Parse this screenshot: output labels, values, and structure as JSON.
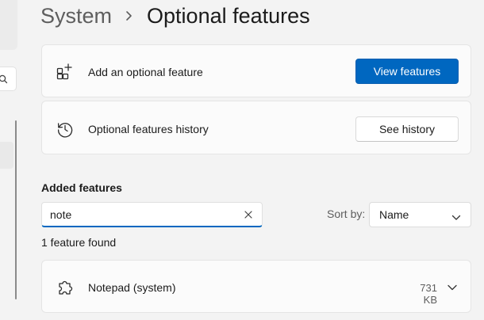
{
  "breadcrumb": {
    "parent": "System",
    "current": "Optional features"
  },
  "add_card": {
    "label": "Add an optional feature",
    "button": "View features",
    "icon": "apps-add-icon"
  },
  "history_card": {
    "label": "Optional features history",
    "button": "See history",
    "icon": "history-icon"
  },
  "added_features": {
    "title": "Added features",
    "search": {
      "value": "note"
    },
    "sort": {
      "label": "Sort by:",
      "value": "Name"
    },
    "result_count": "1 feature found",
    "items": [
      {
        "name": "Notepad (system)",
        "size": "731 KB",
        "icon": "puzzle-icon"
      }
    ]
  },
  "colors": {
    "accent": "#0067c0",
    "background": "#f3f3f3",
    "card": "#fbfbfb"
  }
}
